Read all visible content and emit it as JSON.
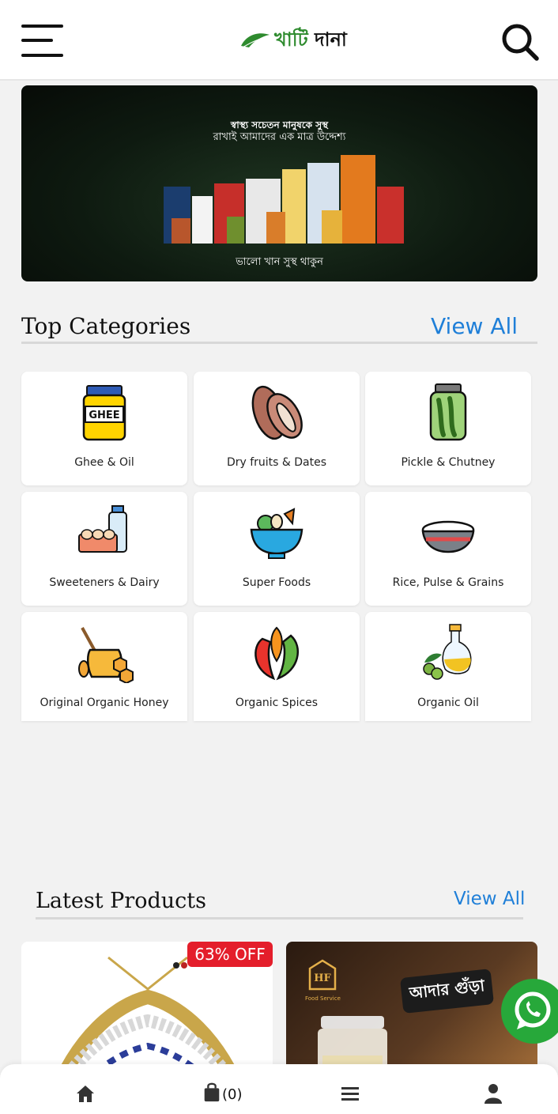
{
  "header": {
    "logo": {
      "part1": "খাটি",
      "part2": "দানা"
    },
    "menu_icon": "hamburger-icon",
    "search_icon": "search-icon"
  },
  "banner": {
    "headline": "স্বাস্থ্য সচেতন মানুষকে সুস্থ",
    "subline": "রাখাই আমাদের এক মাত্র উদ্দেশ্য",
    "tagline": "ভালো খান সুস্থ থাকুন",
    "active_slide": 2,
    "total_slides": 2
  },
  "categories": {
    "title": "Top Categories",
    "view_all": "View All",
    "items": [
      {
        "label": "Ghee & Oil",
        "icon": "ghee-jar-icon"
      },
      {
        "label": "Dry fruits & Dates",
        "icon": "dates-icon"
      },
      {
        "label": "Pickle & Chutney",
        "icon": "pickle-jar-icon"
      },
      {
        "label": "Sweeteners & Dairy",
        "icon": "eggs-milk-icon"
      },
      {
        "label": "Super Foods",
        "icon": "food-bowl-icon"
      },
      {
        "label": "Rice, Pulse & Grains",
        "icon": "rice-bowl-icon"
      },
      {
        "label": "Original Organic Honey",
        "icon": "honey-icon"
      },
      {
        "label": "Organic Spices",
        "icon": "chili-icon"
      },
      {
        "label": "Organic Oil",
        "icon": "olive-oil-icon"
      }
    ]
  },
  "latest": {
    "title": "Latest Products",
    "view_all": "View All",
    "products": [
      {
        "badge": "63% OFF",
        "image": "necklace-image"
      },
      {
        "banner_text": "আদার গুঁড়া",
        "brand": "Food Service",
        "image": "ginger-powder-jar-image"
      }
    ]
  },
  "bottom_nav": {
    "cart_count": "(0)",
    "items": [
      "home-icon",
      "shopping-bag-icon",
      "menu-icon",
      "user-icon"
    ]
  },
  "colors": {
    "accent": "#1f7fd8",
    "badge": "#e41e2b",
    "whatsapp": "#27a83a",
    "logo_green": "#2e8b2e"
  }
}
